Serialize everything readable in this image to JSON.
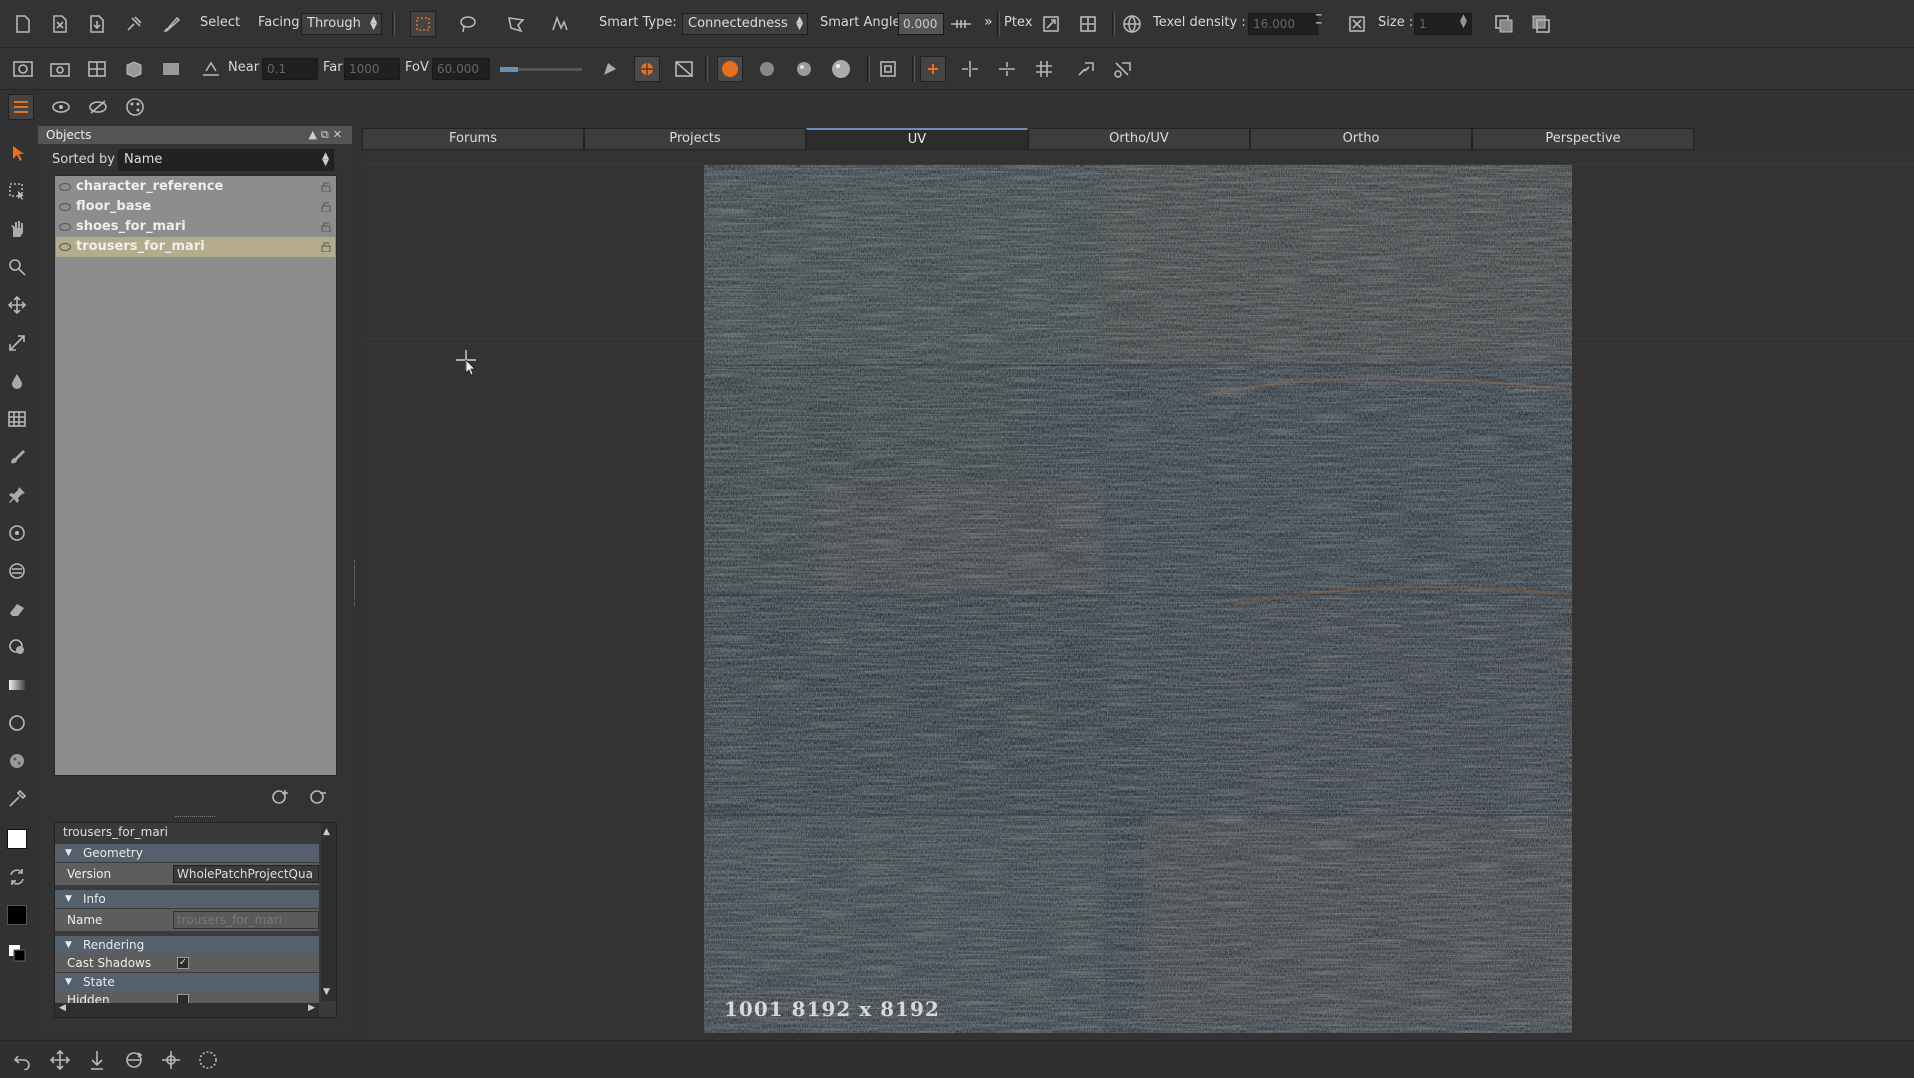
{
  "toolbar1": {
    "select_label": "Select",
    "facing_label": "Facing",
    "facing_value": "Through",
    "smart_type_label": "Smart Type:",
    "smart_type_value": "Connectedness",
    "smart_angle_label": "Smart Angle",
    "smart_angle_value": "0.000",
    "more_glyph": "»",
    "ptex_label": "Ptex",
    "texel_density_label": "Texel density :",
    "texel_density_value": "16.000",
    "size_label": "Size :",
    "size_value": "1"
  },
  "toolbar2": {
    "near_label": "Near",
    "near_value": "0.1",
    "far_label": "Far",
    "far_value": "1000",
    "fov_label": "FoV",
    "fov_value": "60.000"
  },
  "objects_panel": {
    "title": "Objects",
    "sorted_by_label": "Sorted by",
    "sorted_by_value": "Name",
    "items": [
      {
        "label": "character_reference",
        "selected": false
      },
      {
        "label": "floor_base",
        "selected": false
      },
      {
        "label": "shoes_for_mari",
        "selected": false
      },
      {
        "label": "trousers_for_mari",
        "selected": true
      }
    ]
  },
  "properties": {
    "object_name": "trousers_for_mari",
    "geometry_section": "Geometry",
    "version_label": "Version",
    "version_value": "WholePatchProjectQua",
    "info_section": "Info",
    "name_label": "Name",
    "name_value": "trousers_for_mari",
    "rendering_section": "Rendering",
    "cast_shadows_label": "Cast Shadows",
    "cast_shadows_checked": true,
    "state_section": "State",
    "hidden_label": "Hidden",
    "hidden_checked": false
  },
  "tabs": [
    {
      "label": "Forums",
      "active": false
    },
    {
      "label": "Projects",
      "active": false
    },
    {
      "label": "UV",
      "active": true
    },
    {
      "label": "Ortho/UV",
      "active": false
    },
    {
      "label": "Ortho",
      "active": false
    },
    {
      "label": "Perspective",
      "active": false
    }
  ],
  "viewport": {
    "uv_tile_label": "1001 8192 x 8192"
  },
  "colors": {
    "accent_orange": "#e8701a",
    "selected_row": "#b4ab8c",
    "section_header": "#54606c",
    "active_tab_border": "#6a8fb4"
  }
}
